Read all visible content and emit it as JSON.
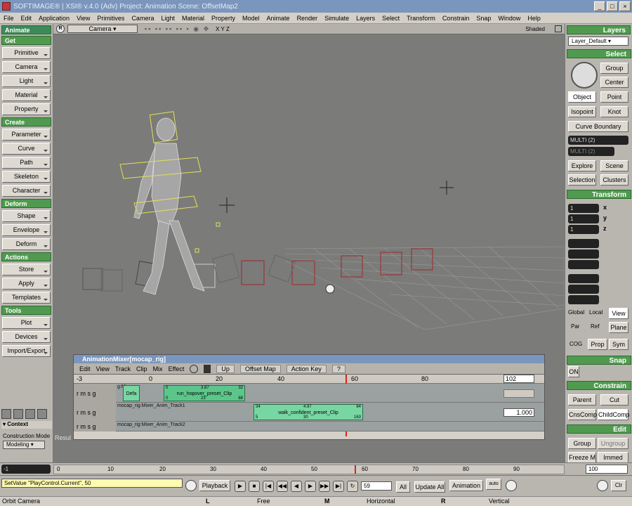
{
  "window": {
    "title": "SOFTIMAGE® | XSI® v.4.0 (Adv) Project: Animation    Scene: OffsetMap2"
  },
  "menu": [
    "File",
    "Edit",
    "Application",
    "View",
    "Primitives",
    "Camera",
    "Light",
    "Material",
    "Property",
    "Model",
    "Animate",
    "Render",
    "Simulate",
    "Layers",
    "Select",
    "Transform",
    "Constrain",
    "Snap",
    "Window",
    "Help"
  ],
  "left": {
    "module": "Animate",
    "sections": [
      {
        "title": "Get",
        "items": [
          "Primitive",
          "Camera",
          "Light",
          "Material",
          "Property"
        ]
      },
      {
        "title": "Create",
        "items": [
          "Parameter",
          "Curve",
          "Path",
          "Skeleton",
          "Character"
        ]
      },
      {
        "title": "Deform",
        "items": [
          "Shape",
          "Envelope",
          "Deform"
        ]
      },
      {
        "title": "Actions",
        "items": [
          "Store",
          "Apply",
          "Templates"
        ]
      },
      {
        "title": "Tools",
        "items": [
          "Plot",
          "Devices",
          "Import/Export"
        ]
      }
    ],
    "context_label": "Context",
    "construction_mode_label": "Construction Mode",
    "construction_mode_value": "Modeling"
  },
  "viewport": {
    "letter": "R",
    "camera": "Camera",
    "axes": "X Y Z",
    "shading": "Shaded",
    "result_label": "Resul"
  },
  "mixer": {
    "title": "AnimationMixer[mocap_rig]",
    "menu": [
      "Edit",
      "View",
      "Track",
      "Clip",
      "Mix",
      "Effect"
    ],
    "buttons": [
      "Up",
      "Offset Map",
      "Action Key",
      "?"
    ],
    "ruler_start": "-3",
    "ruler_end": "102",
    "ruler_ticks": [
      "0",
      "20",
      "40",
      "60",
      "80"
    ],
    "track_ctrl": "r m s g",
    "tracks": [
      {
        "label": "g:Mixer_",
        "clips": [
          {
            "name": "Defa",
            "start": "",
            "mid": "",
            "end": ""
          },
          {
            "name": "run_hopover_preset_Clip",
            "start": "0",
            "mid": "3.87",
            "end": "32",
            "bottom_start": "0",
            "bottom_mid": "23",
            "bottom_end": "88"
          }
        ],
        "weight": ""
      },
      {
        "label": "mocap_rig:Mixer_Anim_Track1",
        "clips": [
          {
            "name": "walk_confident_preset_Clip",
            "start": "34",
            "mid": "4.97",
            "end": "64",
            "bottom_start": "5",
            "bottom_mid": "30",
            "bottom_end": "163"
          }
        ],
        "weight": "1.000"
      },
      {
        "label": "mocap_rig:Mixer_Anim_Track2",
        "clips": [],
        "weight": ""
      }
    ]
  },
  "right": {
    "layers_title": "Layers",
    "layer_value": "Layer_Default",
    "select_title": "Select",
    "select_buttons": [
      "Group",
      "Center",
      "Object",
      "Point",
      "Isopoint",
      "Knot",
      "Curve Boundary"
    ],
    "multi1": "MULTI (2)",
    "multi2": "MULTI (2)",
    "explore": [
      "Explore",
      "Scene",
      "Selection",
      "Clusters"
    ],
    "transform_title": "Transform",
    "scale_values": [
      "1",
      "1",
      "1"
    ],
    "axis_letters": [
      "x",
      "y",
      "z"
    ],
    "ref_buttons": [
      "Global",
      "Local",
      "View",
      "Par",
      "Ref",
      "Plane"
    ],
    "cog_buttons": [
      "COG",
      "Prop",
      "Sym"
    ],
    "snap_title": "Snap",
    "snap_on": "ON",
    "constrain_title": "Constrain",
    "constrain_buttons": [
      "Parent",
      "Cut",
      "CnsComp",
      "ChildComp"
    ],
    "edit_title": "Edit",
    "edit_buttons": [
      "Group",
      "Ungroup",
      "Freeze M",
      "Immed"
    ]
  },
  "timeline": {
    "start": "-1",
    "end": "100",
    "ticks": [
      "0",
      "10",
      "20",
      "30",
      "40",
      "50",
      "60",
      "70",
      "80",
      "90"
    ]
  },
  "playback": {
    "script_value": "SetValue \"PlayControl.Current\", 50",
    "playback_label": "Playback",
    "frame": "59",
    "all_label": "All",
    "update_label": "Update All",
    "animation_label": "Animation",
    "auto_label": "auto",
    "clr_label": "Clr"
  },
  "status": {
    "left": "Orbit Camera",
    "l_hint": "Free",
    "m_hint": "Horizontal",
    "r_hint": "Vertical"
  }
}
